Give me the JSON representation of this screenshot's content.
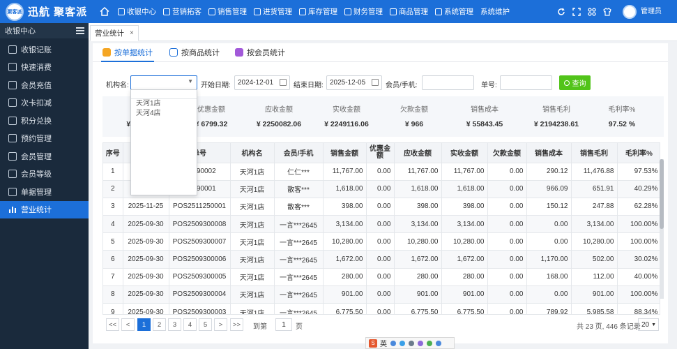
{
  "brand": {
    "logo_text": "聚客派",
    "name": "迅航 聚客派"
  },
  "topnav": [
    {
      "label": "收银中心"
    },
    {
      "label": "营销拓客"
    },
    {
      "label": "销售管理"
    },
    {
      "label": "进货管理"
    },
    {
      "label": "库存管理"
    },
    {
      "label": "财务管理"
    },
    {
      "label": "商品管理"
    },
    {
      "label": "系统管理"
    },
    {
      "label": "系统维护"
    }
  ],
  "user": {
    "name": "管理员"
  },
  "sidebar": {
    "title": "收银中心",
    "items": [
      {
        "label": "收银记账"
      },
      {
        "label": "快速消费"
      },
      {
        "label": "会员充值"
      },
      {
        "label": "次卡扣减"
      },
      {
        "label": "积分兑换"
      },
      {
        "label": "预约管理"
      },
      {
        "label": "会员管理"
      },
      {
        "label": "会员等级"
      },
      {
        "label": "单据管理"
      },
      {
        "label": "营业统计"
      }
    ]
  },
  "tabs": {
    "active_label": "营业统计",
    "close": "×"
  },
  "subtabs": [
    {
      "label": "按单据统计"
    },
    {
      "label": "按商品统计"
    },
    {
      "label": "按会员统计"
    }
  ],
  "filter": {
    "org_label": "机构名:",
    "org_value": "",
    "start_label": "开始日期:",
    "start_value": "2024-12-01",
    "end_label": "结束日期:",
    "end_value": "2025-12-05",
    "member_label": "会员/手机:",
    "member_value": "",
    "order_label": "单号:",
    "order_value": "",
    "query_label": "查询"
  },
  "org_options": [
    "天河1店",
    "天河4店"
  ],
  "summary": [
    {
      "label": "",
      "value": "¥ 2..."
    },
    {
      "label": "优惠金额",
      "value": "¥ 6799.32"
    },
    {
      "label": "应收金额",
      "value": "¥ 2250082.06"
    },
    {
      "label": "实收金额",
      "value": "¥ 2249116.06"
    },
    {
      "label": "欠款金额",
      "value": "¥ 966"
    },
    {
      "label": "销售成本",
      "value": "¥ 55843.45"
    },
    {
      "label": "销售毛利",
      "value": "¥ 2194238.61"
    },
    {
      "label": "毛利率%",
      "value": "97.52 %"
    }
  ],
  "table": {
    "headers": [
      "序号",
      "",
      "单号",
      "机构名",
      "会员/手机",
      "销售金额",
      "优惠金额",
      "应收金额",
      "实收金额",
      "欠款金额",
      "销售成本",
      "销售毛利",
      "毛利率%"
    ],
    "rows": [
      [
        "1",
        "2...",
        "...1290002",
        "天河1店",
        "仁仁***",
        "11,767.00",
        "0.00",
        "11,767.00",
        "11,767.00",
        "0.00",
        "290.12",
        "11,476.88",
        "97.53%"
      ],
      [
        "2",
        "2...",
        "...1290001",
        "天河1店",
        "散客***",
        "1,618.00",
        "0.00",
        "1,618.00",
        "1,618.00",
        "0.00",
        "966.09",
        "651.91",
        "40.29%"
      ],
      [
        "3",
        "2025-11-25",
        "POS2511250001",
        "天河1店",
        "散客***",
        "398.00",
        "0.00",
        "398.00",
        "398.00",
        "0.00",
        "150.12",
        "247.88",
        "62.28%"
      ],
      [
        "4",
        "2025-09-30",
        "POS2509300008",
        "天河1店",
        "一言***2645",
        "3,134.00",
        "0.00",
        "3,134.00",
        "3,134.00",
        "0.00",
        "0.00",
        "3,134.00",
        "100.00%"
      ],
      [
        "5",
        "2025-09-30",
        "POS2509300007",
        "天河1店",
        "一言***2645",
        "10,280.00",
        "0.00",
        "10,280.00",
        "10,280.00",
        "0.00",
        "0.00",
        "10,280.00",
        "100.00%"
      ],
      [
        "6",
        "2025-09-30",
        "POS2509300006",
        "天河1店",
        "一言***2645",
        "1,672.00",
        "0.00",
        "1,672.00",
        "1,672.00",
        "0.00",
        "1,170.00",
        "502.00",
        "30.02%"
      ],
      [
        "7",
        "2025-09-30",
        "POS2509300005",
        "天河1店",
        "一言***2645",
        "280.00",
        "0.00",
        "280.00",
        "280.00",
        "0.00",
        "168.00",
        "112.00",
        "40.00%"
      ],
      [
        "8",
        "2025-09-30",
        "POS2509300004",
        "天河1店",
        "一言***2645",
        "901.00",
        "0.00",
        "901.00",
        "901.00",
        "0.00",
        "0.00",
        "901.00",
        "100.00%"
      ],
      [
        "9",
        "2025-09-30",
        "POS2509300003",
        "天河1店",
        "一言***2645",
        "6,775.50",
        "0.00",
        "6,775.50",
        "6,775.50",
        "0.00",
        "789.92",
        "5,985.58",
        "88.34%"
      ]
    ]
  },
  "pager": {
    "first": "<<",
    "prev": "<",
    "pages": [
      "1",
      "2",
      "3",
      "4",
      "5"
    ],
    "next": ">",
    "last": ">>",
    "goto_label": "到第",
    "goto_value": "1",
    "goto_unit": "页",
    "total_text": "共 23 页, 446 条记录",
    "page_size": "20"
  },
  "ime": {
    "label": "英"
  },
  "colors": {
    "primary": "#1c6fd9",
    "sidebar": "#1a2a3c",
    "query_button": "#52c41a"
  }
}
